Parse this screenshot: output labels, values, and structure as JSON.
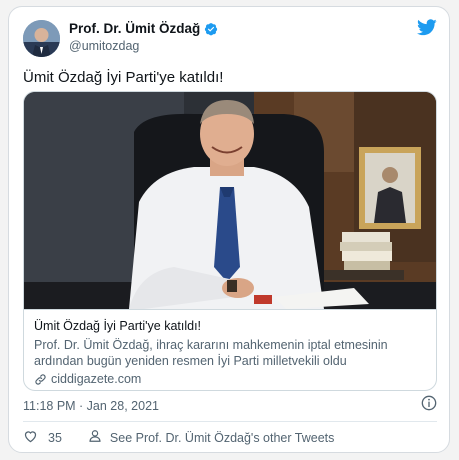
{
  "author": {
    "name": "Prof. Dr. Ümit Özdağ",
    "handle": "@umitozdag",
    "verified": true,
    "avatar_icon": "avatar-photo"
  },
  "tweet": {
    "text": "Ümit Özdağ İyi Parti'ye katıldı!",
    "timestamp": "11:18 PM · Jan 28, 2021"
  },
  "card": {
    "title": "Ümit Özdağ İyi Parti'ye katıldı!",
    "description": "Prof. Dr. Ümit Özdağ, ihraç kararını mahkemenin iptal etmesinin ardından bugün yeniden resmen İyi Parti milletvekili oldu",
    "domain": "ciddigazete.com"
  },
  "actions": {
    "like_count": "35",
    "see_more_label": "See Prof. Dr. Ümit Özdağ's other Tweets"
  },
  "colors": {
    "brand": "#1d9bf0",
    "text_primary": "#0f1419",
    "text_secondary": "#536471"
  },
  "icons": [
    "twitter-bird-icon",
    "verified-badge-icon",
    "link-icon",
    "info-icon",
    "heart-icon",
    "person-icon"
  ]
}
